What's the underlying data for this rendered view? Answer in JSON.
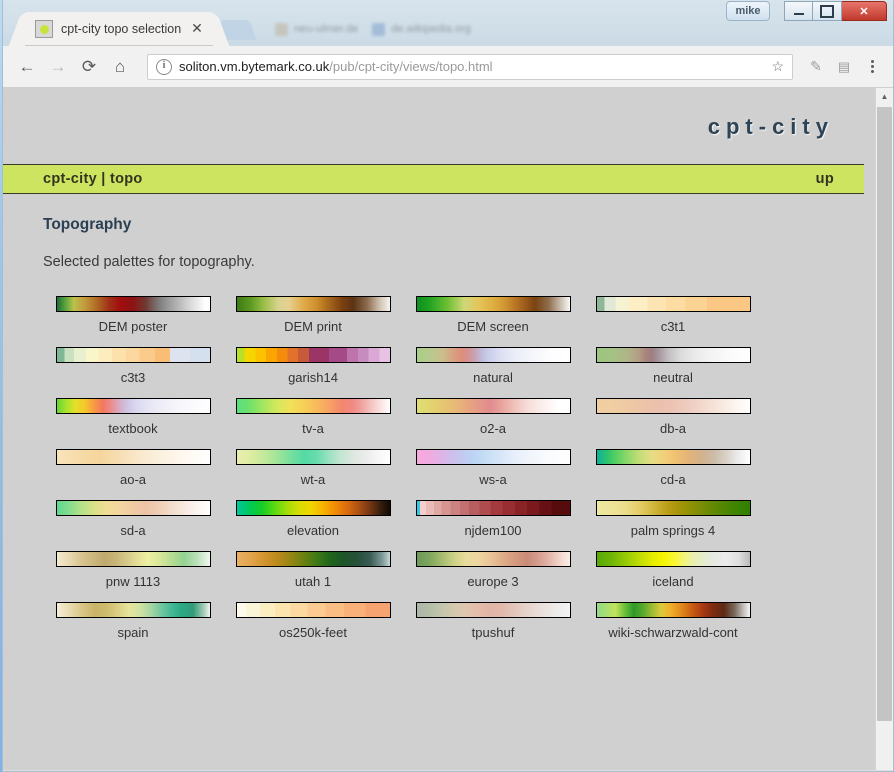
{
  "window": {
    "user_button_label": "mike",
    "minimize_label": "",
    "maximize_label": "",
    "close_label": "✕"
  },
  "browser": {
    "tab": {
      "title": "cpt-city topo selection",
      "close_label": "✕",
      "favicon": "green-dot-favicon"
    },
    "ghost_tabs": [
      {
        "title": "neu-ulmer.de"
      },
      {
        "title": "de.wikipedia.org"
      }
    ],
    "toolbar": {
      "back_label": "←",
      "forward_label": "→",
      "reload_label": "⟳",
      "home_label": "⌂",
      "info_label": "i",
      "url_host": "soliton.vm.bytemark.co.uk",
      "url_path": "/pub/cpt-city/views/topo.html",
      "bookmark_label": "☆",
      "extension1_label": "✎",
      "extension2_label": "▤",
      "menu_label": "⋮"
    }
  },
  "page": {
    "brand": "cpt-city",
    "nav": {
      "breadcrumb": "cpt-city | topo",
      "up_label": "up"
    },
    "title": "Topography",
    "description": "Selected palettes for topography.",
    "scroll": {
      "up_arrow": "▲"
    }
  },
  "palettes": [
    {
      "name": "DEM poster",
      "gradient": "linear-gradient(90deg,#1f6d3a 0%,#55a03e 5%,#b9c24a 11%,#c39a3e 18%,#b06a24 26%,#a03018 34%,#a00d0d 42%,#8c1414 50%,#6e3b32 58%,#7f7f7f 67%,#a8a8a8 76%,#d4d4d4 86%,#ffffff 97%,#ffffff 100%)"
    },
    {
      "name": "DEM print",
      "gradient": "linear-gradient(90deg,#3e7a16 0%,#5d9a20 9%,#9cc04a 18%,#d8d38f 27%,#e6cf90 34%,#e0a945 44%,#cf8f2e 52%,#a8671c 60%,#7a3f10 69%,#5c3314 76%,#8c6b4e 85%,#cfc0ae 93%,#f7f4f0 100%)"
    },
    {
      "name": "DEM screen",
      "gradient": "linear-gradient(90deg,#0f8f20 0%,#25a524 9%,#6fbf33 20%,#cfd77a 31%,#e4c65c 40%,#dfae3e 50%,#cf9330 58%,#a9661d 68%,#7a4312 77%,#8f6d4e 86%,#cbbfb0 94%,#fbfaf8 100%)"
    },
    {
      "name": "c3t1",
      "gradient": "linear-gradient(90deg,#8fb79a 0%,#8fb79a 5%,#dfe9d6 5%,#dfe9d6 12%,#f6f3d4 12%,#f6f3d4 21%,#fdeec3 21%,#fdeec3 33%,#fde5b3 33%,#fde5b3 45%,#fcdca3 45%,#fcdca3 58%,#fbd392 58%,#fbd392 72%,#fac884 72%,#fac884 100%)"
    },
    {
      "name": "c3t3",
      "gradient": "linear-gradient(90deg,#7fb695 0%,#7fb695 5%,#c9e0c1 5%,#c9e0c1 11%,#e9f0cf 11%,#e9f0cf 19%,#f9f6c9 19%,#f9f6c9 27%,#fdedbe 27%,#fdedbe 36%,#fde1ad 36%,#fde1ad 45%,#fcd79e 45%,#fcd79e 54%,#fbcb8c 54%,#fbcb8c 64%,#f9bd76 64%,#f9bd76 74%,#dde3ef 74%,#dde3ef 87%,#d5e0ef 87%,#d5e0ef 100%)"
    },
    {
      "name": "garish14",
      "gradient": "linear-gradient(90deg,#b8e02a 0%,#b8e02a 5%,#f6d500 5%,#f6d500 12%,#fcc200 12%,#fcc200 19%,#fba600 19%,#fba600 26%,#f58b0d 26%,#f58b0d 33%,#e2722b 33%,#e2722b 40%,#c85a3c 40%,#c85a3c 47%,#9b3566 47%,#9b3566 60%,#a44a86 60%,#a44a86 72%,#bc74ab 72%,#bc74ab 79%,#c68cc0 79%,#c68cc0 86%,#d9a8d4 86%,#d9a8d4 93%,#e6c3e3 93%,#e6c3e3 100%)"
    },
    {
      "name": "natural",
      "gradient": "linear-gradient(90deg,#a6cf86 0%,#b9c98e 9%,#cbbd8c 17%,#d99f82 24%,#dd8f79 29%,#d6908e 33%,#c7a3b9 38%,#bfc0de 43%,#cdd0ec 48%,#dde0f2 55%,#eceef8 65%,#f6f7fb 77%,#fefeff 90%,#ffffff 100%)"
    },
    {
      "name": "neutral",
      "gradient": "linear-gradient(90deg,#9cc67f 0%,#a5c184 11%,#b0b489 20%,#b39f84 27%,#a8837a 32%,#9c7f82 36%,#a99aa0 41%,#c4c0c4 47%,#dcdcdc 55%,#eaeaea 64%,#f3f3f3 74%,#fbfbfb 87%,#ffffff 100%)"
    },
    {
      "name": "textbook",
      "gradient": "linear-gradient(90deg,#64d635 0%,#a8e32c 6%,#e4e028 12%,#f6c82c 18%,#f79c42 24%,#f2775e 30%,#ec8a8a 35%,#dba7bd 40%,#cfc0e0 45%,#d9d6ef 51%,#e6e5f4 60%,#f0eff8 70%,#f8f8fc 82%,#ffffff 100%)"
    },
    {
      "name": "tv-a",
      "gradient": "linear-gradient(90deg,#59df7f 0%,#6fe06b 8%,#a3e65f 17%,#d8e85c 27%,#f2e05a 35%,#f7cf58 44%,#f7b85c 53%,#f79f65 61%,#f4866f 69%,#f08a85 76%,#f0a6a2 82%,#f4c6c3 88%,#fae3e2 94%,#ffffff 100%)"
    },
    {
      "name": "o2-a",
      "gradient": "linear-gradient(90deg,#e0df72 0%,#e2d570 8%,#e6c671 17%,#e8b779 26%,#e7a480 34%,#e4968b 42%,#e28b8e 48%,#e9a79e 56%,#f0c3bb 64%,#f6dcd7 72%,#fbefec 82%,#ffffff 92%,#ffffff 100%)"
    },
    {
      "name": "db-a",
      "gradient": "linear-gradient(90deg,#f0cfa0 0%,#f0cda2 10%,#efc9a4 20%,#edc4a8 30%,#ebc0ac 40%,#ecc4b4 50%,#eecdc0 60%,#f2dacd 70%,#f7e7dd 80%,#fcf4ee 90%,#ffffff 100%)"
    },
    {
      "name": "ao-a",
      "gradient": "linear-gradient(90deg,#f8e3bb 0%,#f8dfb0 9%,#f6d9a4 19%,#f5d59c 28%,#f6dcae 38%,#f8e4c1 48%,#faebd2 58%,#fbf1e0 68%,#fdf6eb 79%,#fefbf5 89%,#ffffff 100%)"
    },
    {
      "name": "wt-a",
      "gradient": "linear-gradient(90deg,#e9edae 0%,#ddeda2 9%,#c3e99b 18%,#9ee49a 27%,#72df9f 36%,#54daa4 44%,#67dcae 52%,#9ae2c1 60%,#c4e6d2 68%,#dde7e0 76%,#ececec 85%,#f8f8f8 93%,#ffffff 100%)"
    },
    {
      "name": "ws-a",
      "gradient": "linear-gradient(90deg,#f8a9dc 0%,#f1abdf 8%,#e2b2e6 15%,#d0bdec 22%,#c3c9f0 29%,#bcd4f3 37%,#c6ddf5 45%,#d6e6f8 54%,#e5eefa 63%,#f0f5fc 73%,#f9fbfe 85%,#ffffff 100%)"
    },
    {
      "name": "cd-a",
      "gradient": "linear-gradient(90deg,#0eaf9a 0%,#2ec46b 7%,#5cd163 13%,#8fd86a 20%,#c4de78 28%,#e6dd86 36%,#f2cf79 44%,#f0c072 52%,#e2b478 60%,#d3b28c 68%,#cbbba5 76%,#d8cfc5 84%,#ececec 92%,#ffffff 100%)"
    },
    {
      "name": "sd-a",
      "gradient": "linear-gradient(90deg,#5fd693 0%,#84dd8d 8%,#b4e288 16%,#dde08a 25%,#f0dd95 33%,#f2d5a0 42%,#f0c9a3 51%,#eec3a6 58%,#efcdb5 66%,#f2dcca 74%,#f6e9e0 83%,#fbf5f1 92%,#ffffff 100%)"
    },
    {
      "name": "elevation",
      "gradient": "linear-gradient(90deg,#00c49a 0%,#00c85c 8%,#15cc27 16%,#55d812 24%,#9ddd08 32%,#d3dd06 40%,#f2d500 48%,#f7b400 56%,#f18d05 64%,#d96c0e 72%,#a84f15 80%,#6b3312 88%,#2e1a0b 95%,#120a05 100%)"
    },
    {
      "name": "njdem100",
      "gradient": "linear-gradient(90deg,#35c6e8 0%,#35c6e8 2%,#f2cfc8 2%,#f2cfc8 6%,#eabbb6 6%,#eabbb6 11%,#e0a8a3 11%,#e0a8a3 16%,#d69590 16%,#d69590 22%,#cc8280 22%,#cc8280 28%,#c27070 28%,#c27070 34%,#b85e60 34%,#b85e60 41%,#ae4c50 41%,#ae4c50 48%,#a43a40 48%,#a43a40 56%,#982e32 56%,#982e32 64%,#8a2326 64%,#8a2326 72%,#7a1a1c 72%,#7a1a1c 80%,#671114 80%,#671114 88%,#560b0d 88%,#560b0d 100%)"
    },
    {
      "name": "palm springs 4",
      "gradient": "linear-gradient(90deg,#efe8a0 0%,#eee49a 9%,#ecdd8a 18%,#e5cf6c 27%,#d4b840 36%,#bda01c 45%,#a49408 54%,#8a9005 63%,#6f8b03 72%,#548702 81%,#3f8402 90%,#2f8001 100%)"
    },
    {
      "name": "pnw 1113",
      "gradient": "linear-gradient(90deg,#f3ead0 0%,#e8d9b2 8%,#d8c490 16%,#cbb67e 24%,#c0a96e 31%,#c7b477 38%,#d4c788 45%,#e2dc96 52%,#eef0a2 59%,#d9e79a 67%,#b6dc92 75%,#93d291 83%,#b8e0b6 91%,#f0f7ef 100%)"
    },
    {
      "name": "utah 1",
      "gradient": "linear-gradient(90deg,#e8b062 0%,#e2a650 8%,#d5952f 17%,#bd8a1c 26%,#9a8715 34%,#6e8210 43%,#3f7a16 52%,#20651b 61%,#1d5428 70%,#26513c 79%,#3b5c54 87%,#7e9a99 95%,#c3d6d4 100%)"
    },
    {
      "name": "europe 3",
      "gradient": "linear-gradient(90deg,#6a9a58 0%,#7fa65e 8%,#a4bb6e 16%,#ccd185 24%,#e8dc9c 32%,#eed6a2 40%,#e9c497 48%,#dfae89 56%,#d59a7e 64%,#c98a78 72%,#d69f92 80%,#e7bdb1 88%,#f5ddd4 95%,#fbeee6 100%)"
    },
    {
      "name": "iceland",
      "gradient": "linear-gradient(90deg,#5aa80a 0%,#6eb508 9%,#93c806 18%,#bddb04 27%,#e2ec02 36%,#f5f400 43%,#f9f62b 50%,#f2f47a 57%,#e9efb0 63%,#e4ecd0 70%,#e6eae4 77%,#ebebeb 85%,#dedede 93%,#b9b9b9 100%)"
    },
    {
      "name": "spain",
      "gradient": "linear-gradient(90deg,#f5eed6 0%,#e9dcb2 8%,#d8c584 17%,#c9b467 25%,#cdbb6c 32%,#dbd084 40%,#e6e49c 47%,#d2e2a2 54%,#a9d6a4 61%,#72c79f 68%,#43b894 75%,#2aa882 82%,#329a78 89%,#a8ccb8 96%,#f0f5f2 100%)"
    },
    {
      "name": "os250k-feet",
      "gradient": "linear-gradient(90deg,#fdfaec 0%,#fdfaec 6%,#fbf5d8 6%,#fbf5d8 15%,#fbeec0 15%,#fbeec0 25%,#fbe4ae 25%,#fbe4ae 35%,#fbd9a0 35%,#fbd9a0 46%,#fbcb92 46%,#fbcb92 58%,#fabd84 58%,#fabd84 70%,#f9b079 70%,#f9b079 84%,#f7a271 84%,#f7a271 100%)"
    },
    {
      "name": "tpushuf",
      "gradient": "linear-gradient(90deg,#aab6a7 0%,#b4bda8 8%,#c2c5ab 16%,#d3c8ae 24%,#e0c6af 32%,#e4bdaa 40%,#e2b5a6 47%,#e1b8ab 55%,#e3c4ba 63%,#e6d2ca 71%,#e9ddd8 79%,#ebe6e3 87%,#eeeeee 94%,#f4f4f4 100%)"
    },
    {
      "name": "wiki-schwarzwald-cont",
      "gradient": "linear-gradient(90deg,#95d88a 0%,#a8dd74 6%,#c2e25c 12%,#6fc03c 18%,#2f9a2a 24%,#57a82c 30%,#9bbc34 36%,#ddc93c 42%,#efb12c 48%,#e08a1c 55%,#c95f14 62%,#a83a12 69%,#7e2a10 76%,#5c2a14 83%,#7a6a5e 90%,#c8c4c0 96%,#f5f5f5 100%)"
    }
  ]
}
